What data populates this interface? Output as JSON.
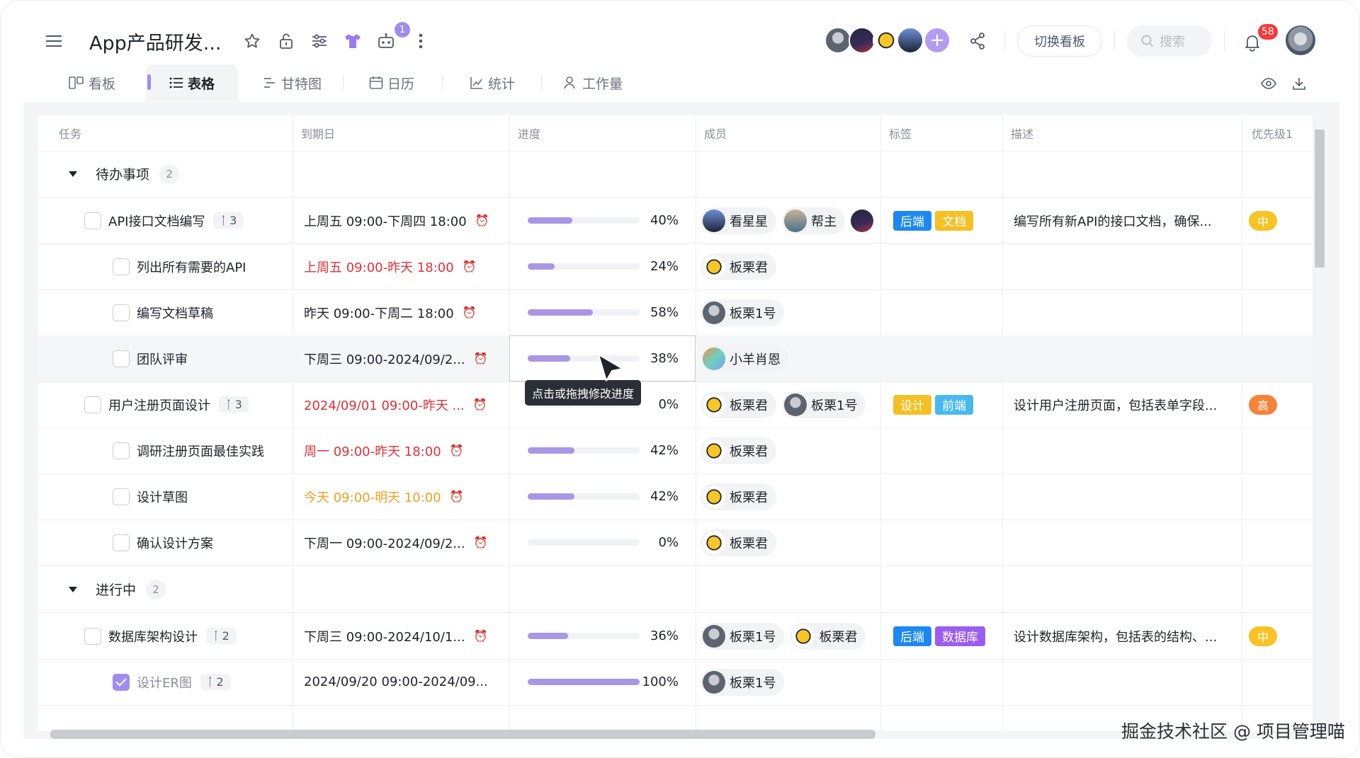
{
  "app": {
    "title": "App产品研发...",
    "notification_count": "1",
    "bell_count": "58",
    "switch_board_label": "切换看板",
    "search_placeholder": "搜索"
  },
  "tabs": [
    {
      "label": "看板"
    },
    {
      "label": "表格"
    },
    {
      "label": "甘特图"
    },
    {
      "label": "日历"
    },
    {
      "label": "统计"
    },
    {
      "label": "工作量"
    }
  ],
  "columns": [
    "任务",
    "到期日",
    "进度",
    "成员",
    "标签",
    "描述",
    "优先级1"
  ],
  "groups": [
    {
      "title": "待办事项",
      "count": "2"
    },
    {
      "title": "进行中",
      "count": "2"
    }
  ],
  "rows": [
    {
      "task": "API接口文档编写",
      "sub": "3",
      "due": "上周五 09:00-下周四 18:00",
      "progress": 40,
      "progress_label": "40%",
      "members": [
        "看星星",
        "帮主"
      ],
      "tags": [
        "后端",
        "文档"
      ],
      "desc": "编写所有新API的接口文档，确保...",
      "prio": "中"
    },
    {
      "task": "列出所有需要的API",
      "due": "上周五 09:00-昨天 18:00",
      "progress": 24,
      "progress_label": "24%",
      "members": [
        "板栗君"
      ]
    },
    {
      "task": "编写文档草稿",
      "due": "昨天 09:00-下周二 18:00",
      "progress": 58,
      "progress_label": "58%",
      "members": [
        "板栗1号"
      ]
    },
    {
      "task": "团队评审",
      "due": "下周三 09:00-2024/09/2...",
      "progress": 38,
      "progress_label": "38%",
      "members": [
        "小羊肖恩"
      ]
    },
    {
      "task": "用户注册页面设计",
      "sub": "3",
      "due": "2024/09/01 09:00-昨天 ...",
      "progress": 0,
      "progress_label": "0%",
      "members": [
        "板栗君",
        "板栗1号"
      ],
      "tags": [
        "设计",
        "前端"
      ],
      "desc": "设计用户注册页面，包括表单字段...",
      "prio": "高"
    },
    {
      "task": "调研注册页面最佳实践",
      "due": "周一 09:00-昨天 18:00",
      "progress": 42,
      "progress_label": "42%",
      "members": [
        "板栗君"
      ]
    },
    {
      "task": "设计草图",
      "due": "今天 09:00-明天 10:00",
      "progress": 42,
      "progress_label": "42%",
      "members": [
        "板栗君"
      ]
    },
    {
      "task": "确认设计方案",
      "due": "下周一 09:00-2024/09/2...",
      "progress": 0,
      "progress_label": "0%",
      "members": [
        "板栗君"
      ]
    },
    {
      "task": "数据库架构设计",
      "sub": "2",
      "due": "下周三 09:00-2024/10/1...",
      "progress": 36,
      "progress_label": "36%",
      "members": [
        "板栗1号",
        "板栗君"
      ],
      "tags": [
        "后端",
        "数据库"
      ],
      "desc": "设计数据库架构，包括表的结构、...",
      "prio": "中"
    },
    {
      "task": "设计ER图",
      "sub": "2",
      "due": "2024/09/20 09:00-2024/09...",
      "progress": 100,
      "progress_label": "100%",
      "members": [
        "板栗1号"
      ]
    }
  ],
  "tooltip": "点击或拖拽修改进度",
  "watermark": "掘金技术社区 @ 项目管理喵",
  "colors": {
    "accent": "#a08cf0",
    "progress": "#a897e5",
    "tag_blue": "#1e88f0",
    "tag_yellow": "#f5c024",
    "tag_purple": "#9b5cf0",
    "tag_cyan": "#48b8f0",
    "prio_mid": "#f7c326",
    "prio_high": "#f7823a",
    "overdue": "#e0303a",
    "today": "#f0a020"
  }
}
